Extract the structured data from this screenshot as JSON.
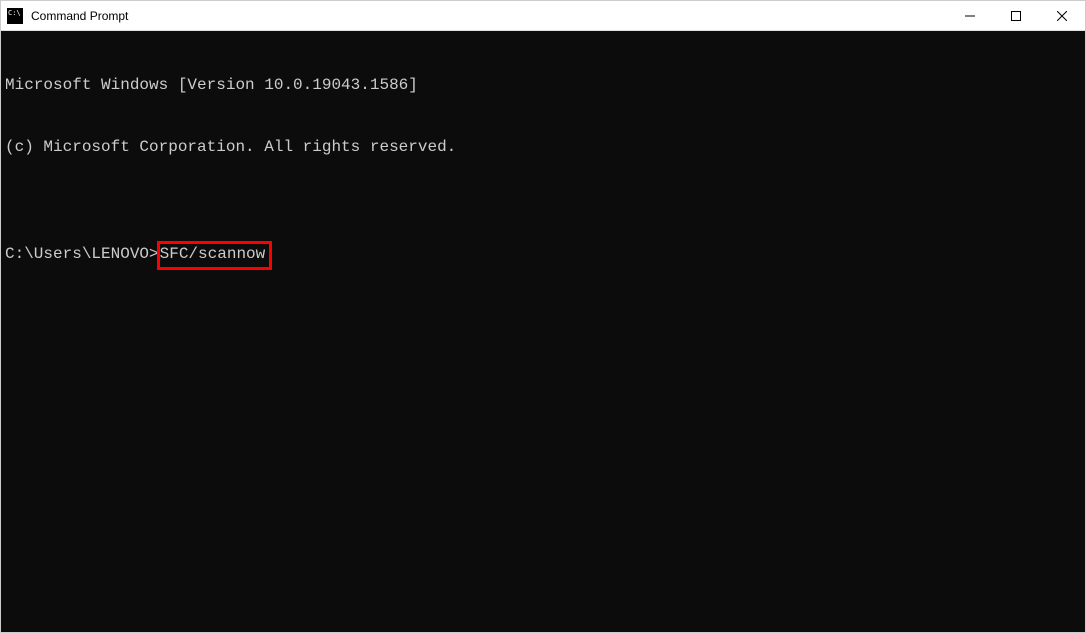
{
  "window": {
    "title": "Command Prompt"
  },
  "terminal": {
    "line1": "Microsoft Windows [Version 10.0.19043.1586]",
    "line2": "(c) Microsoft Corporation. All rights reserved.",
    "blank": "",
    "prompt": "C:\\Users\\LENOVO>",
    "command": "SFC/scannow"
  }
}
